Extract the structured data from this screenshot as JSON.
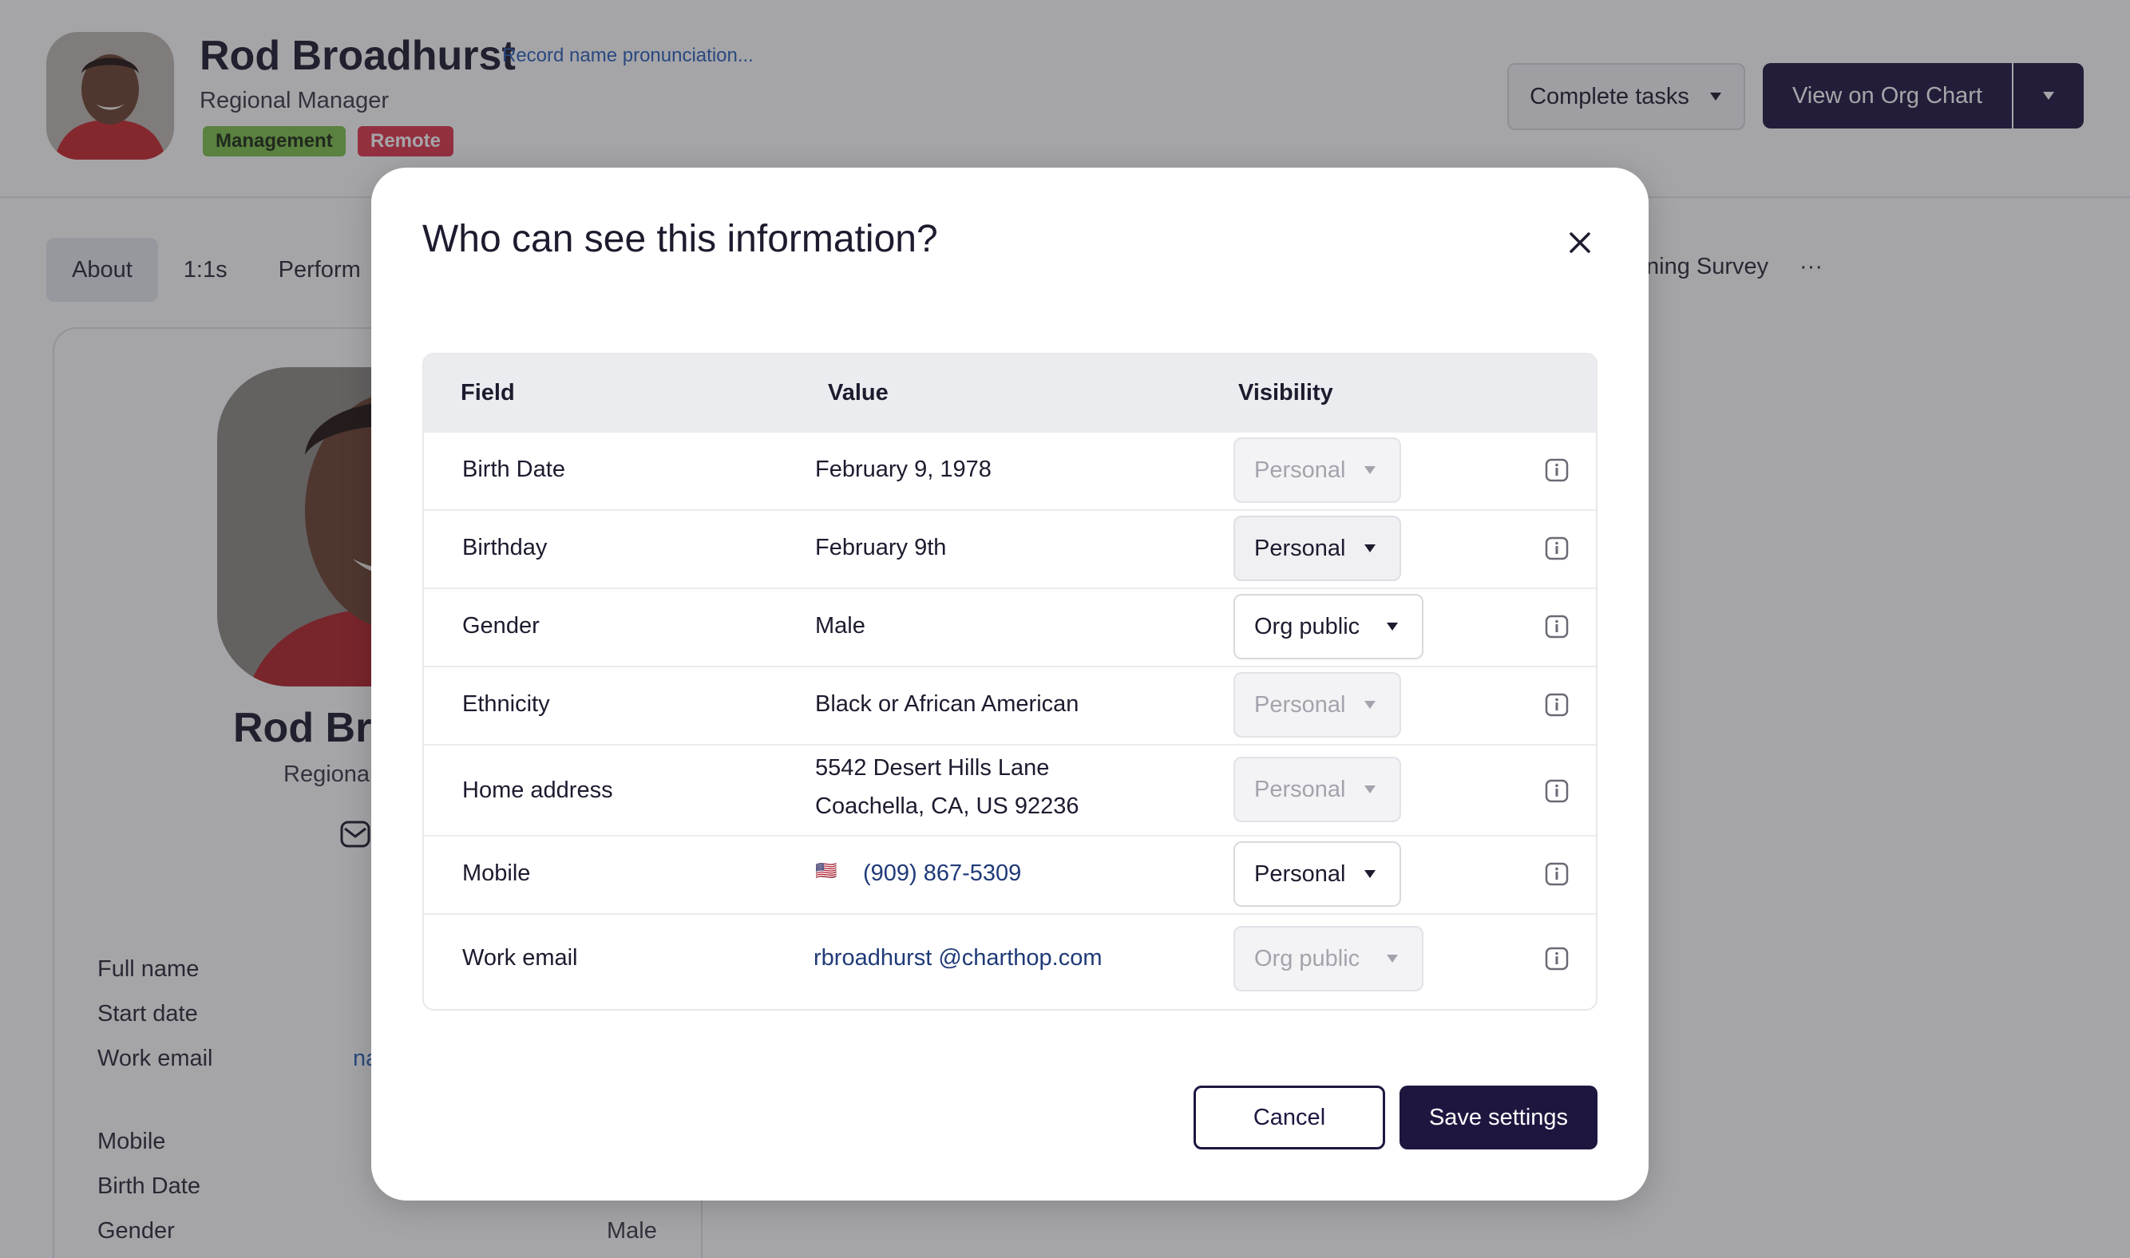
{
  "profile": {
    "name": "Rod Broadhurst",
    "pronunciation_link": "Record name pronunciation...",
    "role": "Regional Manager",
    "tags": [
      "Management",
      "Remote"
    ],
    "complete_tasks": "Complete tasks",
    "view_org_chart": "View on Org Chart"
  },
  "tabs": {
    "about": "About",
    "one_on_ones": "1:1s",
    "performance": "Perform",
    "survey": "ning Survey",
    "more": "···"
  },
  "card": {
    "name": "Rod Bro",
    "role": "Regional",
    "labels": [
      "Full name",
      "Start date",
      "Work email",
      "Mobile",
      "Birth Date",
      "Gender"
    ],
    "work_email_partial": "na",
    "gender_value": "Male"
  },
  "modal": {
    "title": "Who can see this information?",
    "headers": {
      "field": "Field",
      "value": "Value",
      "visibility": "Visibility"
    },
    "rows": [
      {
        "field": "Birth Date",
        "value": "February 9, 1978",
        "visibility": "Personal"
      },
      {
        "field": "Birthday",
        "value": "February 9th",
        "visibility": "Personal"
      },
      {
        "field": "Gender",
        "value": "Male",
        "visibility": "Org public"
      },
      {
        "field": "Ethnicity",
        "value": "Black or African American",
        "visibility": "Personal"
      },
      {
        "field": "Home address",
        "value_line1": "5542 Desert Hills Lane",
        "value_line2": "Coachella, CA, US 92236",
        "visibility": "Personal"
      },
      {
        "field": "Mobile",
        "flag": "🇺🇸",
        "value": "(909) 867-5309",
        "visibility": "Personal"
      },
      {
        "field": "Work email",
        "value": "rbroadhurst @charthop.com",
        "visibility": "Org public"
      }
    ],
    "cancel": "Cancel",
    "save": "Save settings"
  },
  "colors": {
    "brand_dark": "#1f1640",
    "tag_management": "#7fc24a",
    "tag_remote": "#e0364c",
    "link": "#2b5fb8"
  }
}
